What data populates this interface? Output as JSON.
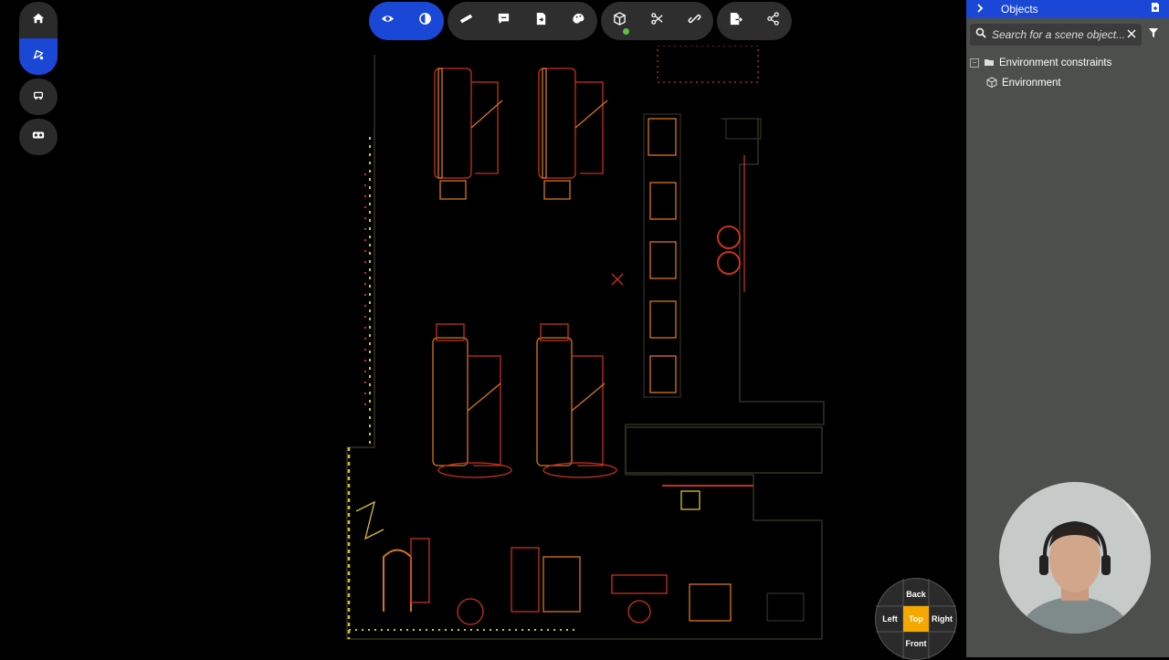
{
  "left_toolbar": {
    "buttons": [
      {
        "icon": "home-icon",
        "active": false
      },
      {
        "icon": "scene-edit-icon",
        "active": true
      },
      {
        "icon": "robot-icon",
        "active": false
      },
      {
        "icon": "vr-headset-icon",
        "active": false
      }
    ]
  },
  "top_toolbar": {
    "groups": [
      [
        "eye-icon",
        "contrast-icon"
      ],
      [
        "ruler-icon",
        "comment-icon",
        "file-import-icon",
        "paint-icon"
      ],
      [
        "cube-icon",
        "scissors-icon",
        "link-icon"
      ],
      [
        "export-icon",
        "share-icon"
      ]
    ]
  },
  "panel": {
    "title": "Objects",
    "search_placeholder": "Search for a scene object...",
    "tree": [
      {
        "label": "Environment constraints",
        "icon": "folder-icon",
        "level": 0,
        "expander": "⊟"
      },
      {
        "label": "Environment",
        "icon": "cube-icon",
        "level": 1
      }
    ]
  },
  "viewcube": {
    "back": "Back",
    "left": "Left",
    "top": "Top",
    "right": "Right",
    "front": "Front"
  },
  "colors": {
    "accent": "#1a47d6",
    "viewcube_active": "#f5a800",
    "panel_bg": "#4d4f4d",
    "pointcloud_red": "#c8321a",
    "pointcloud_orange": "#d8761c",
    "pointcloud_yellow": "#d8c02a"
  }
}
